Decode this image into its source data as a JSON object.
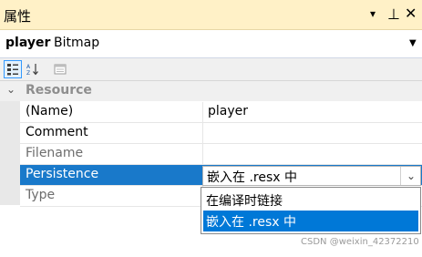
{
  "window": {
    "title": "属性"
  },
  "title_buttons": {
    "dropdown_glyph": "▾",
    "pin_glyph": "⊥",
    "close_glyph": "✕"
  },
  "object": {
    "name": "player",
    "type": "Bitmap"
  },
  "toolbar": {
    "buttons": [
      {
        "icon": "categorized-icon",
        "active": true
      },
      {
        "icon": "alphabetical-icon",
        "active": false
      },
      {
        "icon": "property-pages-icon",
        "active": false
      }
    ]
  },
  "category": {
    "label": "Resource",
    "expanded": true,
    "chevron": "⌄"
  },
  "rows": [
    {
      "name": "(Name)",
      "value": "player"
    },
    {
      "name": "Comment",
      "value": ""
    },
    {
      "name": "Filename",
      "value": ""
    },
    {
      "name": "Persistence",
      "value": "嵌入在 .resx 中"
    },
    {
      "name": "Type",
      "value": ""
    }
  ],
  "dropdown": {
    "options": [
      {
        "label": "在编译时链接",
        "selected": false
      },
      {
        "label": "嵌入在 .resx 中",
        "selected": true
      }
    ]
  },
  "watermark": "CSDN @weixin_42372210",
  "colors": {
    "title_bar": "#fff1c7",
    "selection": "#1979ca",
    "list_selection": "#0078d7"
  }
}
